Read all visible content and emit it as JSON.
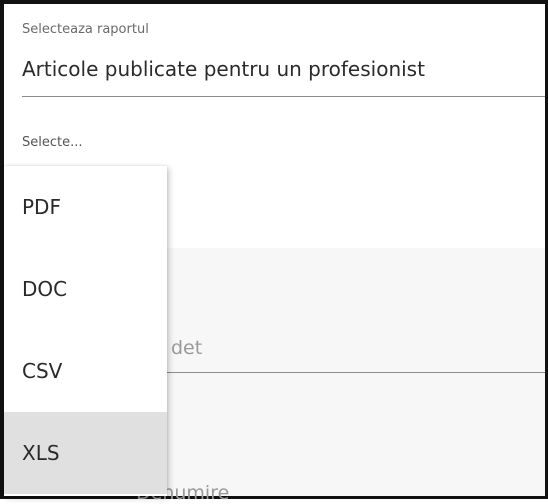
{
  "report": {
    "label": "Selecteaza raportul",
    "value": "Articole publicate pentru un profesionist"
  },
  "format_select": {
    "label": "Selecte...",
    "options": [
      "PDF",
      "DOC",
      "CSV",
      "XLS"
    ],
    "selected": "XLS"
  },
  "background_fields": {
    "field_1_partial": "det",
    "field_2_partial": "Denumire"
  }
}
